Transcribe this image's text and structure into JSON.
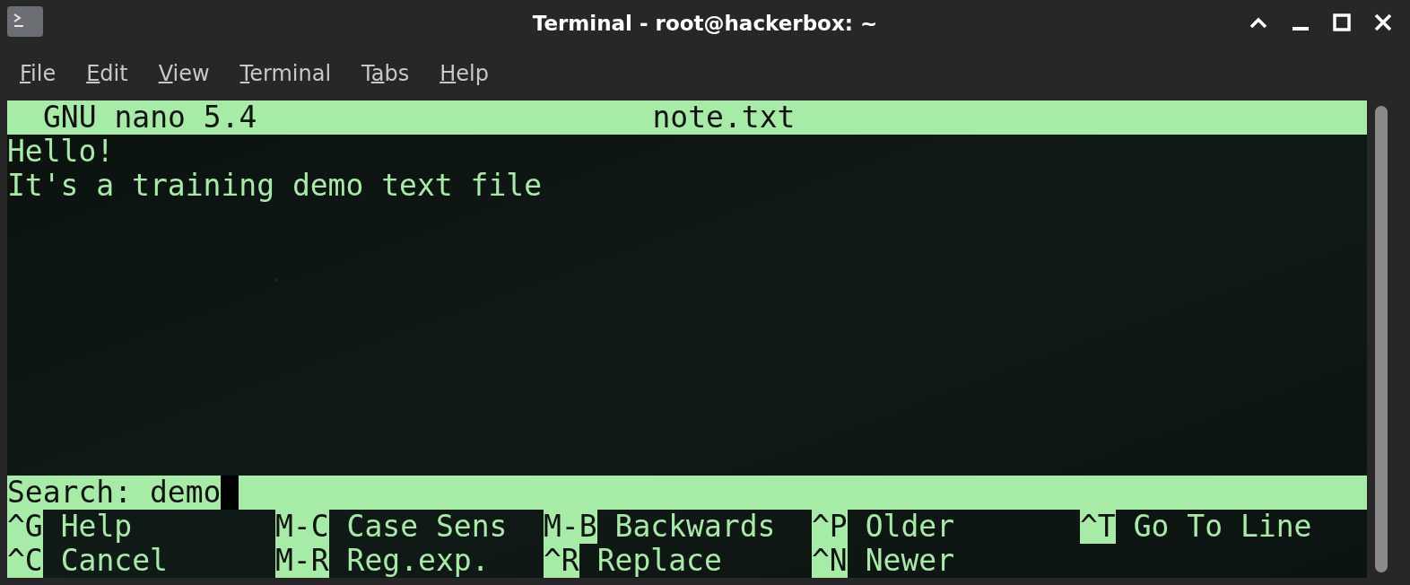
{
  "window": {
    "title": "Terminal - root@hackerbox: ~"
  },
  "menu": [
    {
      "key": "F",
      "post": "ile"
    },
    {
      "key": "E",
      "post": "dit"
    },
    {
      "key": "V",
      "post": "iew"
    },
    {
      "key": "T",
      "post": "erminal"
    },
    {
      "pre": "T",
      "key": "a",
      "post": "bs"
    },
    {
      "key": "H",
      "post": "elp"
    }
  ],
  "nano": {
    "version": "GNU nano 5.4",
    "filename": "note.txt",
    "lines": [
      "Hello!",
      "It's a training demo text file"
    ],
    "search": {
      "prompt": "Search: ",
      "value": "demo"
    },
    "shortcuts": [
      [
        {
          "key": "^G",
          "label": "Help"
        },
        {
          "key": "M-C",
          "label": "Case Sens"
        },
        {
          "key": "M-B",
          "label": "Backwards"
        },
        {
          "key": "^P",
          "label": "Older"
        },
        {
          "key": "^T",
          "label": "Go To Line"
        }
      ],
      [
        {
          "key": "^C",
          "label": "Cancel"
        },
        {
          "key": "M-R",
          "label": "Reg.exp."
        },
        {
          "key": "^R",
          "label": "Replace"
        },
        {
          "key": "^N",
          "label": "Newer"
        }
      ]
    ]
  }
}
